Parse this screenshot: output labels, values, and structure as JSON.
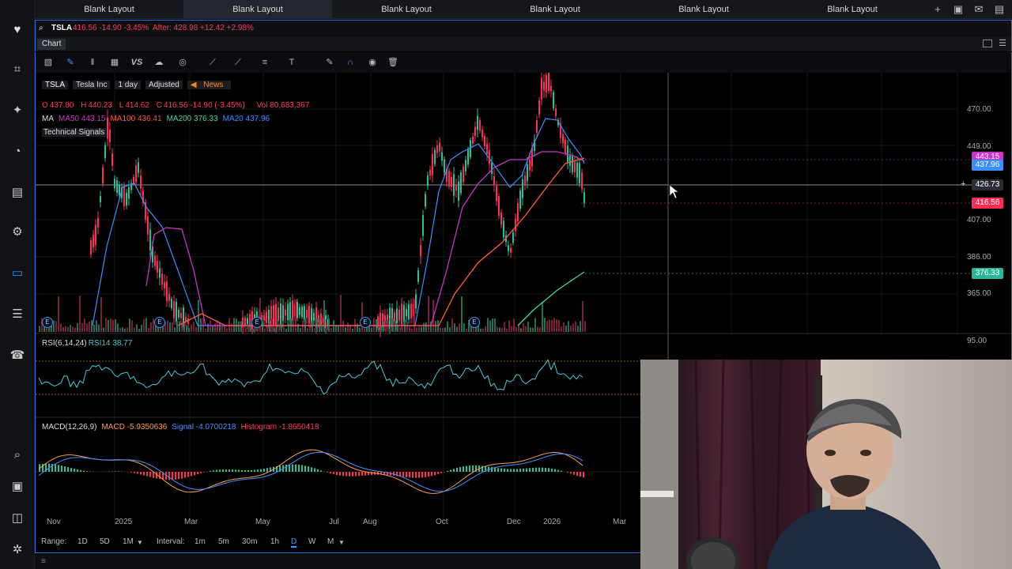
{
  "tabs": [
    "Blank Layout",
    "Blank Layout",
    "Blank Layout",
    "Blank Layout",
    "Blank Layout",
    "Blank Layout"
  ],
  "symbol_bar": {
    "symbol": "TSLA",
    "quote": "416.56 -14.90 -3.45%",
    "after": "After: 428.98 +12.42 +2.98%"
  },
  "chart_label": "Chart",
  "header": {
    "symbol": "TSLA",
    "company": "Tesla Inc",
    "period": "1 day",
    "adjusted": "Adjusted",
    "news": "News"
  },
  "ohlc": {
    "o_label": "O",
    "o": "437.80",
    "h_label": "H",
    "h": "440.23",
    "l_label": "L",
    "l": "414.62",
    "c_label": "C",
    "c": "416.56 -14.90 (-3.45%)",
    "vol": "Vol 80,683,367"
  },
  "ma_legend": {
    "label": "MA",
    "ma50": "MA50 443.15",
    "ma100": "MA100 436.41",
    "ma200": "MA200 376.33",
    "ma20": "MA20 437.96"
  },
  "technical_signals": "Technical Signals",
  "price_axis": {
    "ticks": [
      "470.00",
      "449.00",
      "407.00",
      "386.00",
      "365.00"
    ],
    "tags": {
      "ma50": "443.15",
      "ma20": "437.96",
      "cursor": "426.73",
      "last": "416.56",
      "ma200": "376.33"
    },
    "rsi_tick": "95.00"
  },
  "rsi_legend": {
    "label": "RSI(6,14,24)",
    "value": "RSI14 38.77"
  },
  "macd_legend": {
    "label": "MACD(12,26,9)",
    "macd": "MACD -5.9350636",
    "signal": "Signal -4.0700218",
    "hist": "Histogram -1.8650418"
  },
  "time_axis": [
    "Nov",
    "2025",
    "Mar",
    "May",
    "Jul",
    "Aug",
    "Oct",
    "Dec",
    "2026",
    "Mar"
  ],
  "event_marker": "E",
  "range_bar": {
    "range_label": "Range:",
    "ranges": [
      "1D",
      "5D",
      "1M"
    ],
    "interval_label": "Interval:",
    "intervals": [
      "1m",
      "5m",
      "30m",
      "1h",
      "D",
      "W",
      "M"
    ]
  },
  "colors": {
    "accent": "#2a6fd6",
    "up": "#26c39a",
    "down": "#ff2d55",
    "ma50": "#c935c9",
    "ma100": "#ff5a3d",
    "ma200": "#43d6b0",
    "ma20": "#3d8eff",
    "rsi": "#48c9d6"
  },
  "icons": [
    "heart-icon",
    "chart-icon",
    "telescope-icon",
    "gauge-icon",
    "news-icon",
    "settings-icon",
    "monitor-icon",
    "list-icon",
    "phone-icon",
    "magnifier-icon",
    "book-icon",
    "chat-icon",
    "gear-icon"
  ]
}
